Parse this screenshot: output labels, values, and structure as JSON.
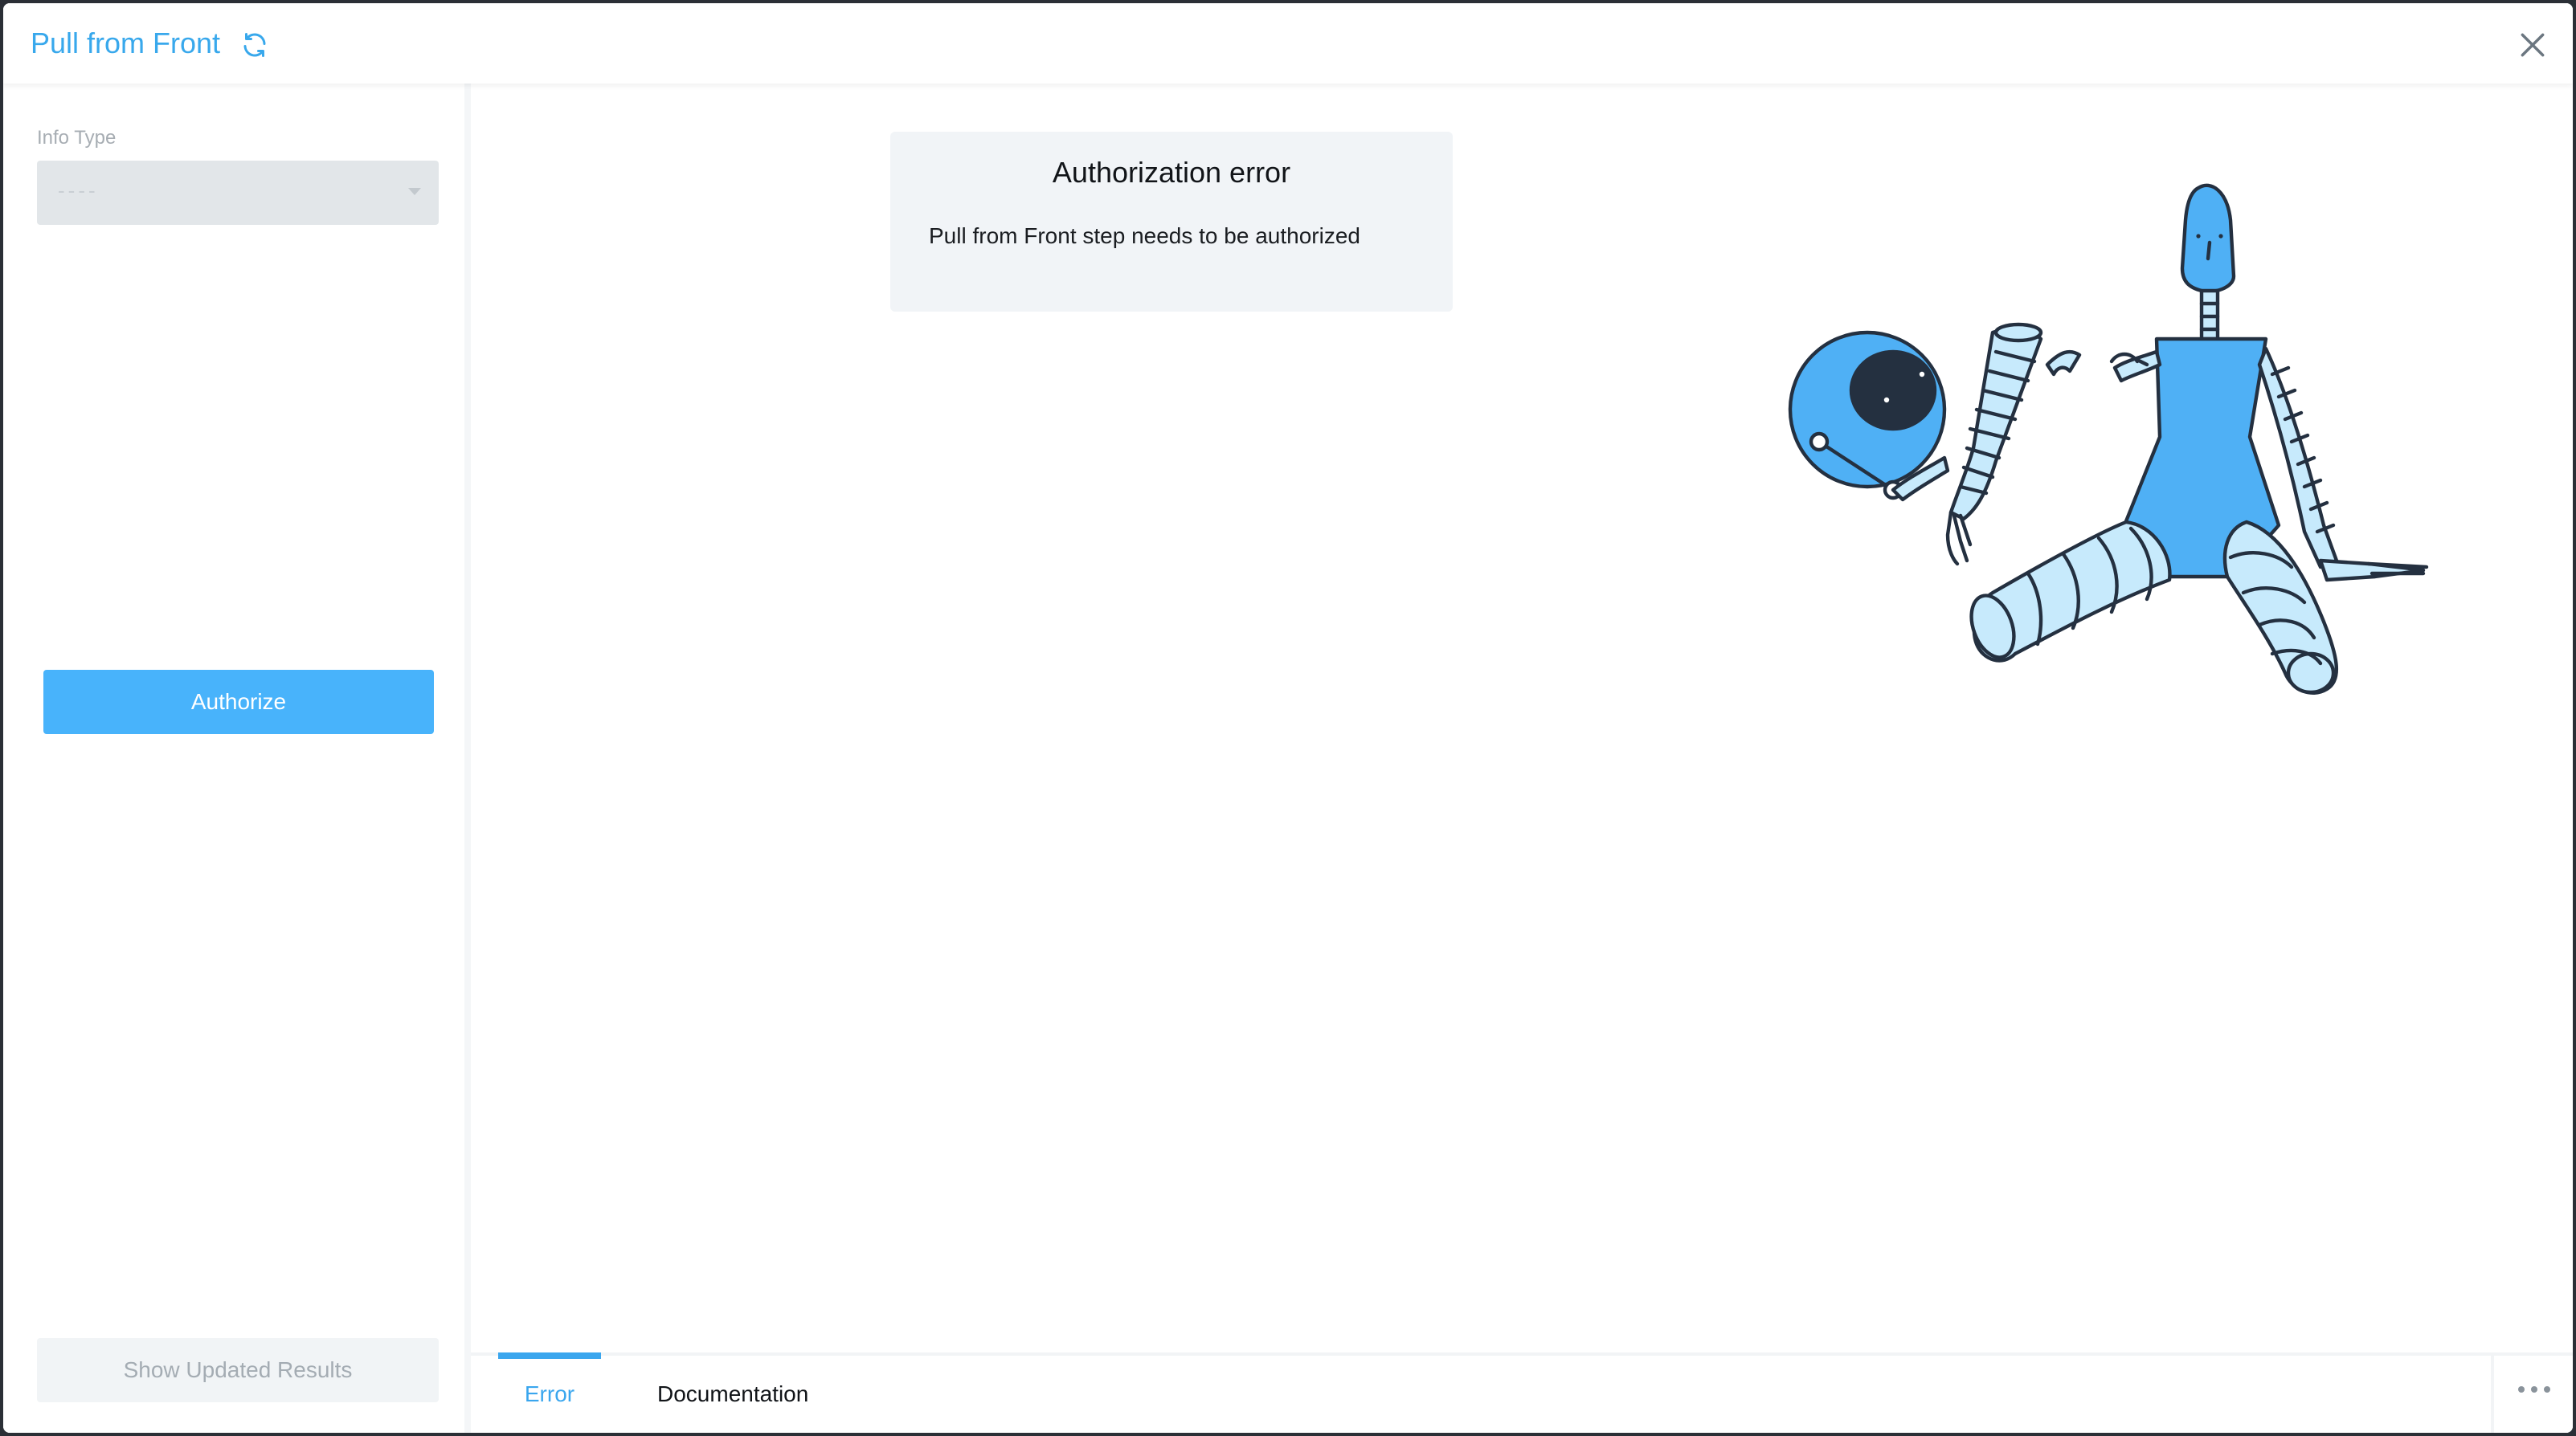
{
  "header": {
    "title": "Pull from Front",
    "refresh_icon": "refresh-icon",
    "close_icon": "close-icon",
    "accent_color": "#38a8ec"
  },
  "sidebar": {
    "info_type_label": "Info Type",
    "info_type_value": "----",
    "authorize_label": "Authorize",
    "show_results_label": "Show Updated Results"
  },
  "main": {
    "error_title": "Authorization error",
    "error_message": "Pull from Front step needs to be authorized",
    "illustration": "robot-illustration"
  },
  "tabs": {
    "items": [
      {
        "label": "Error",
        "active": true
      },
      {
        "label": "Documentation",
        "active": false
      }
    ],
    "more_icon": "more-horizontal-icon"
  }
}
